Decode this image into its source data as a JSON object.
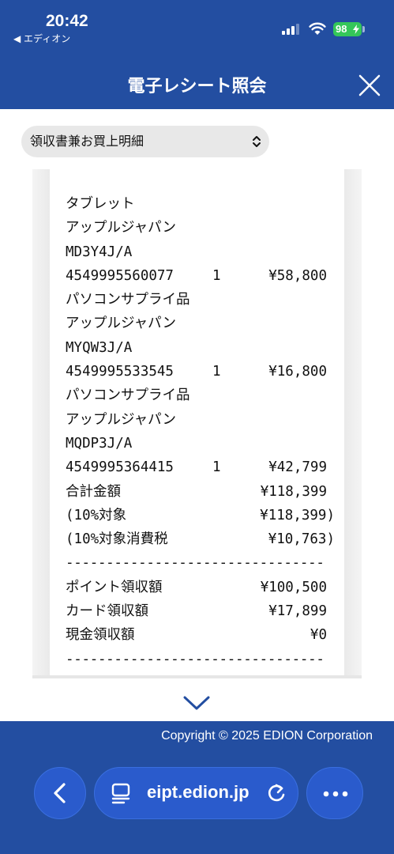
{
  "status_bar": {
    "time": "20:42",
    "back_app": "◀ エディオン",
    "battery": "98"
  },
  "header": {
    "title": "電子レシート照会"
  },
  "selector": {
    "value": "領収書兼お買上明細"
  },
  "receipt": {
    "lines": [
      {
        "text": "タブレット"
      },
      {
        "text": "アップルジャパン"
      },
      {
        "text": "MD3Y4J/A"
      },
      {
        "text": "4549995560077",
        "qty": "1",
        "amount": "¥58,800"
      },
      {
        "text": "パソコンサプライ品"
      },
      {
        "text": "アップルジャパン"
      },
      {
        "text": "MYQW3J/A"
      },
      {
        "text": "4549995533545",
        "qty": "1",
        "amount": "¥16,800"
      },
      {
        "text": "パソコンサプライ品"
      },
      {
        "text": "アップルジャパン"
      },
      {
        "text": "MQDP3J/A"
      },
      {
        "text": "4549995364415",
        "qty": "1",
        "amount": "¥42,799"
      },
      {
        "text": "合計金額",
        "amount": "¥118,399"
      },
      {
        "text": " (10%対象",
        "amount": "¥118,399)"
      },
      {
        "text": " (10%対象消費税",
        "amount": "¥10,763)"
      },
      {
        "text": "--------------------------------"
      },
      {
        "text": "ポイント領収額",
        "amount": "¥100,500"
      },
      {
        "text": "カード領収額",
        "amount": "¥17,899"
      },
      {
        "text": "現金領収額",
        "amount": "¥0"
      },
      {
        "text": "--------------------------------"
      }
    ]
  },
  "footer": {
    "copyright": "Copyright © 2025 EDION Corporation",
    "url": "eipt.edion.jp"
  },
  "colors": {
    "brand_blue": "#234ea1",
    "button_blue": "#2a5bcc",
    "battery_green": "#34c759"
  },
  "icons": [
    "signal-icon",
    "wifi-icon",
    "close-icon",
    "chevron-updown-icon",
    "chevron-down-icon",
    "back-arrow-icon",
    "tabs-icon",
    "reload-icon",
    "more-icon"
  ]
}
